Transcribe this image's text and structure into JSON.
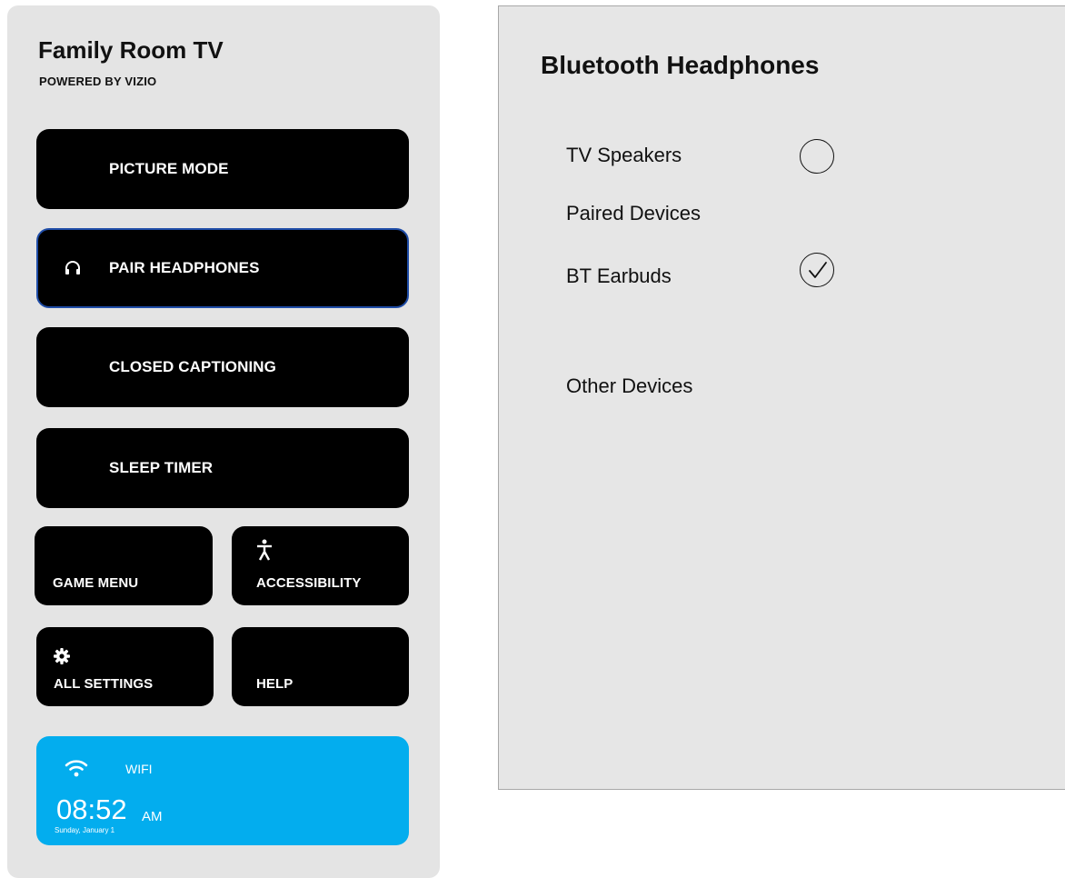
{
  "sidebar": {
    "device_name": "Family Room TV",
    "powered_by": "POWERED BY VIZIO",
    "menu": {
      "picture_mode": "PICTURE MODE",
      "pair_headphones": "PAIR HEADPHONES",
      "closed_captioning": "CLOSED CAPTIONING",
      "sleep_timer": "SLEEP TIMER",
      "game_menu": "GAME MENU",
      "accessibility": "ACCESSIBILITY",
      "all_settings": "ALL SETTINGS",
      "help": "HELP"
    },
    "status": {
      "wifi_label": "WIFI",
      "time": "08:52",
      "ampm": "AM",
      "date": "Sunday, January 1"
    }
  },
  "panel": {
    "title": "Bluetooth Headphones",
    "tv_speakers": "TV Speakers",
    "paired_devices_header": "Paired Devices",
    "bt_earbuds": "BT Earbuds",
    "other_devices_header": "Other Devices",
    "tv_speakers_selected": false,
    "bt_earbuds_selected": true
  },
  "icons": {
    "pair_headphones": "headphones-icon",
    "accessibility": "accessibility-icon",
    "all_settings": "gear-icon",
    "wifi": "wifi-icon",
    "tv_speakers": "radio-unchecked-icon",
    "bt_earbuds": "radio-checked-icon"
  },
  "colors": {
    "tile_bg": "#000000",
    "selected_border": "#1f4da8",
    "wifi_card": "#03adee",
    "sidebar_bg": "#e4e4e4",
    "panel_bg": "#e6e6e6"
  }
}
